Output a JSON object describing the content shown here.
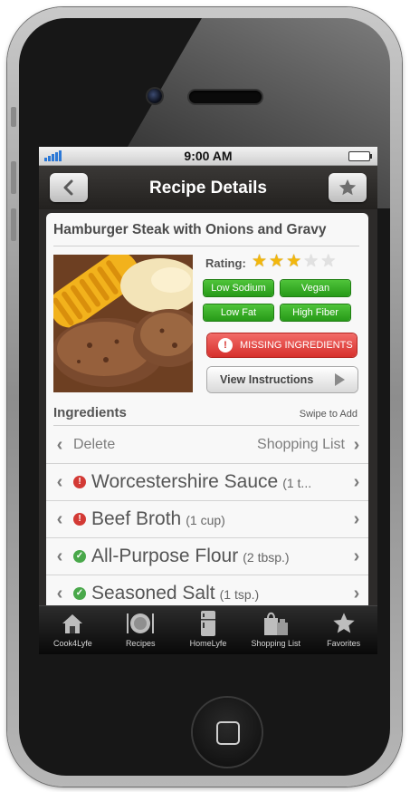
{
  "status_bar": {
    "time": "9:00 AM"
  },
  "nav": {
    "title": "Recipe Details",
    "back_icon": "chevron-left-icon",
    "favorite_icon": "star-icon"
  },
  "recipe": {
    "title": "Hamburger Steak with Onions and Gravy",
    "rating_label": "Rating:",
    "rating": 3,
    "rating_max": 5,
    "tags": [
      "Low Sodium",
      "Vegan",
      "Low Fat",
      "High Fiber"
    ],
    "missing_button": "MISSING INGREDIENTS",
    "view_button": "View Instructions"
  },
  "ingredients": {
    "heading": "Ingredients",
    "hint": "Swipe to Add",
    "actions": {
      "left": "Delete",
      "right": "Shopping List"
    },
    "items": [
      {
        "name": "Worcestershire Sauce",
        "qty": "(1 t...",
        "status": "missing"
      },
      {
        "name": "Beef Broth",
        "qty": "(1 cup)",
        "status": "missing"
      },
      {
        "name": "All-Purpose Flour",
        "qty": "(2 tbsp.)",
        "status": "have"
      },
      {
        "name": "Seasoned Salt",
        "qty": "(1 tsp.)",
        "status": "have"
      }
    ]
  },
  "tabbar": [
    {
      "label": "Cook4Lyfe",
      "icon": "house-icon"
    },
    {
      "label": "Recipes",
      "icon": "plate-icon"
    },
    {
      "label": "HomeLyfe",
      "icon": "fridge-icon"
    },
    {
      "label": "Shopping List",
      "icon": "shopping-bag-icon"
    },
    {
      "label": "Favorites",
      "icon": "star-icon"
    }
  ],
  "colors": {
    "tag_green": "#2fa81f",
    "missing_red": "#d6302c",
    "star_gold": "#f2b70d"
  }
}
